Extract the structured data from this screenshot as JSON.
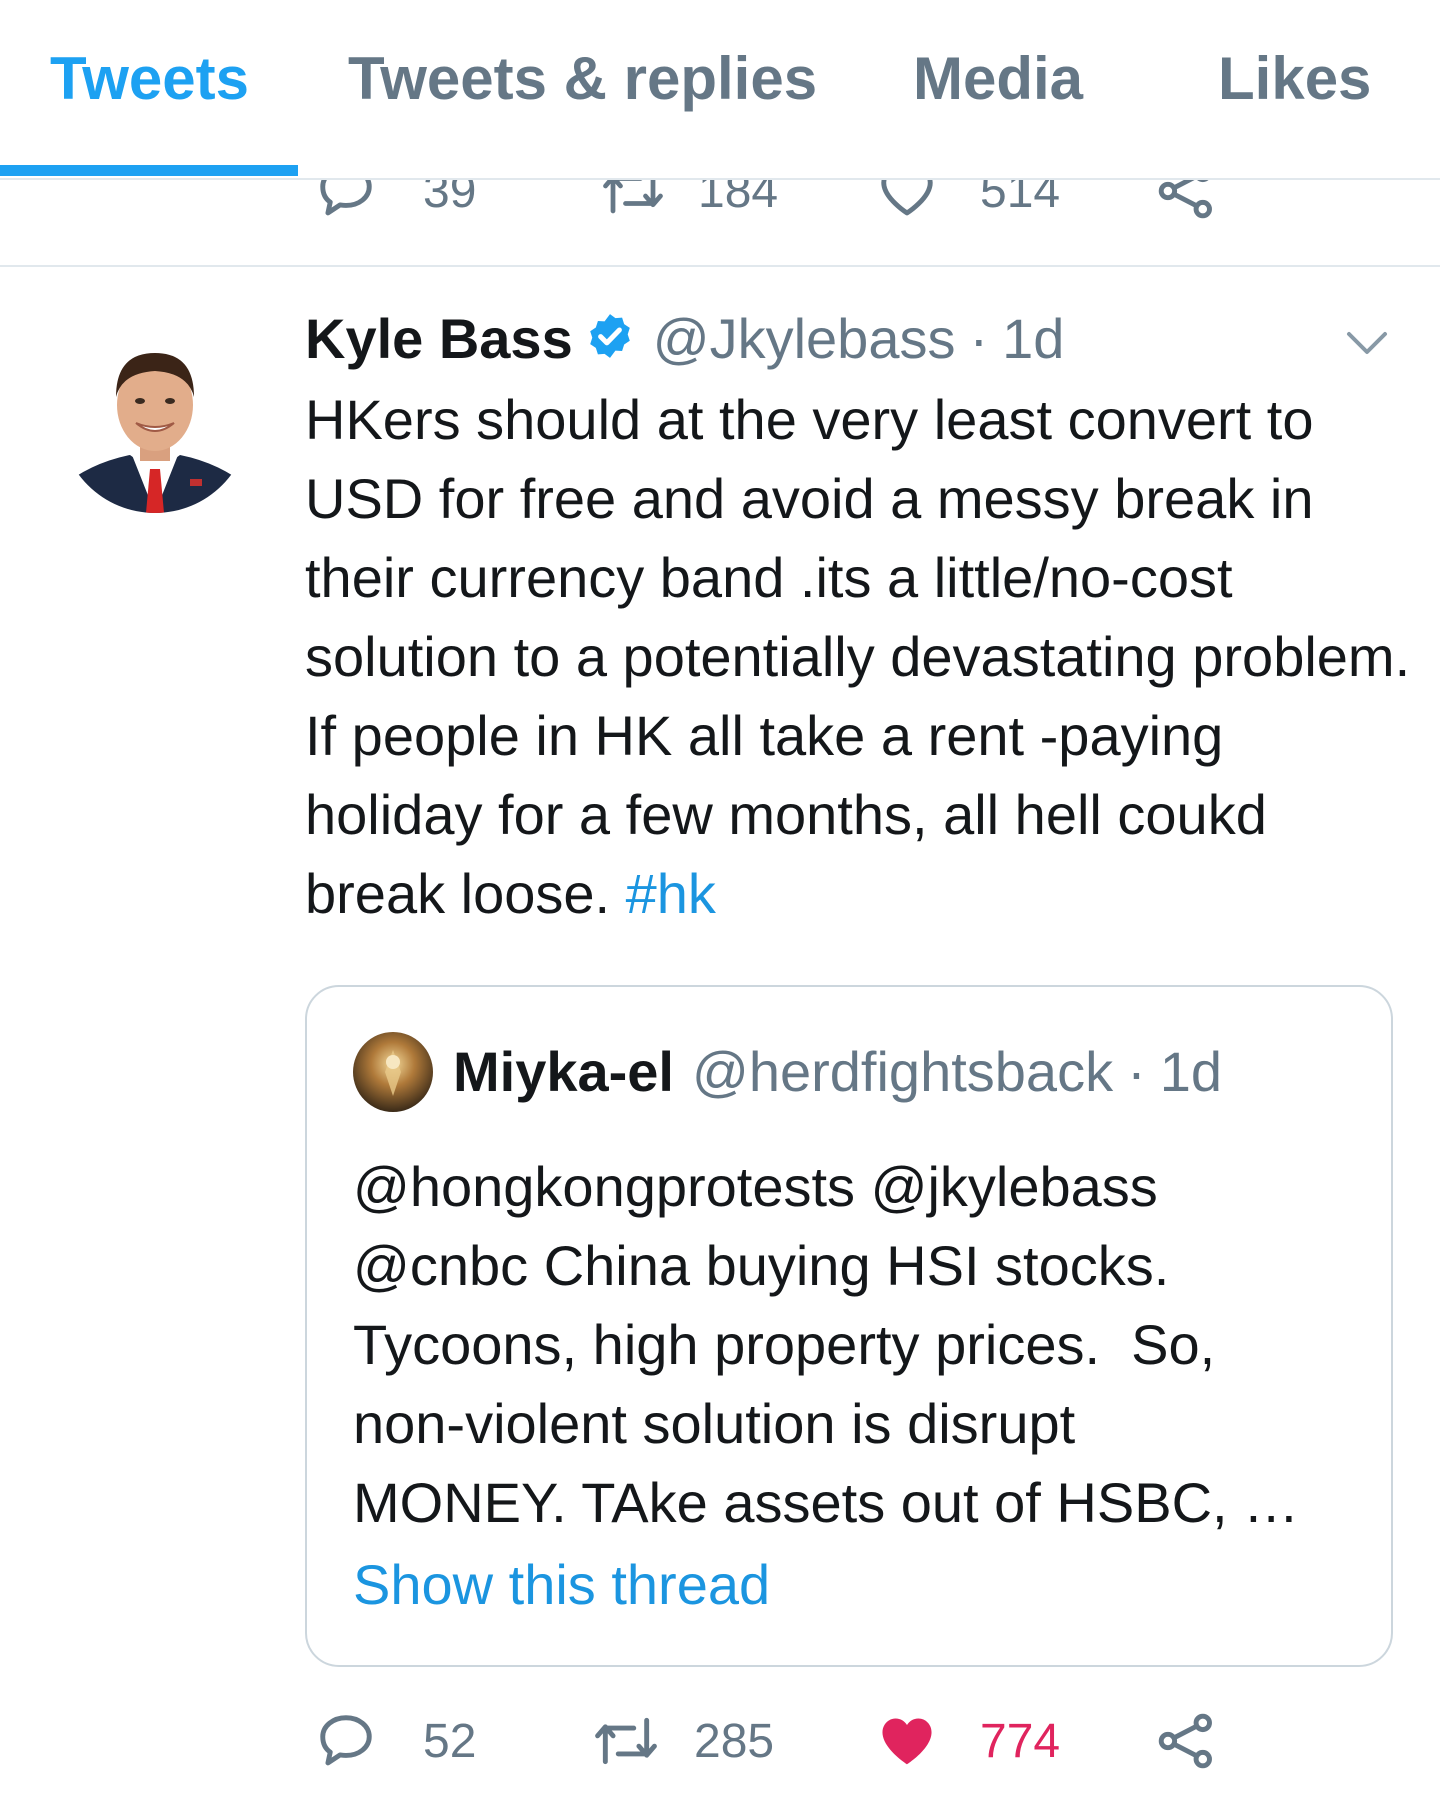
{
  "tabs": [
    {
      "label": "Tweets",
      "active": true
    },
    {
      "label": "Tweets & replies",
      "active": false
    },
    {
      "label": "Media",
      "active": false
    },
    {
      "label": "Likes",
      "active": false
    }
  ],
  "previous_tweet": {
    "replies": "39",
    "retweets": "184",
    "likes": "514"
  },
  "tweet": {
    "author_name": "Kyle Bass",
    "verified": true,
    "handle": "@Jkylebass",
    "separator": "·",
    "time": "1d",
    "text": "HKers should at the very least convert to USD for free and avoid a messy break in their currency band .its a little/no-cost solution to a potentially devastating problem. If people in HK all take a rent -paying holiday for a few months, all hell coukd break loose. ",
    "hashtag": "#hk",
    "quoted": {
      "author_name": "Miyka-el",
      "handle": "@herdfightsback",
      "separator": "·",
      "time": "1d",
      "text": "@hongkongprotests @jkylebass\n@cnbc China buying HSI stocks.\nTycoons, high property prices.  So,\nnon-violent solution is disrupt\nMONEY. TAke assets out of HSBC, …",
      "show_thread": "Show this thread"
    },
    "stats": {
      "replies": "52",
      "retweets": "285",
      "likes": "774",
      "liked": true
    }
  },
  "colors": {
    "accent": "#1da1f2",
    "link": "#1b95e0",
    "muted": "#657786",
    "like": "#e0245e",
    "border": "#ccd6dd"
  },
  "icons": [
    "reply-icon",
    "retweet-icon",
    "heart-icon",
    "share-icon",
    "verified-badge-icon",
    "chevron-down-icon"
  ]
}
